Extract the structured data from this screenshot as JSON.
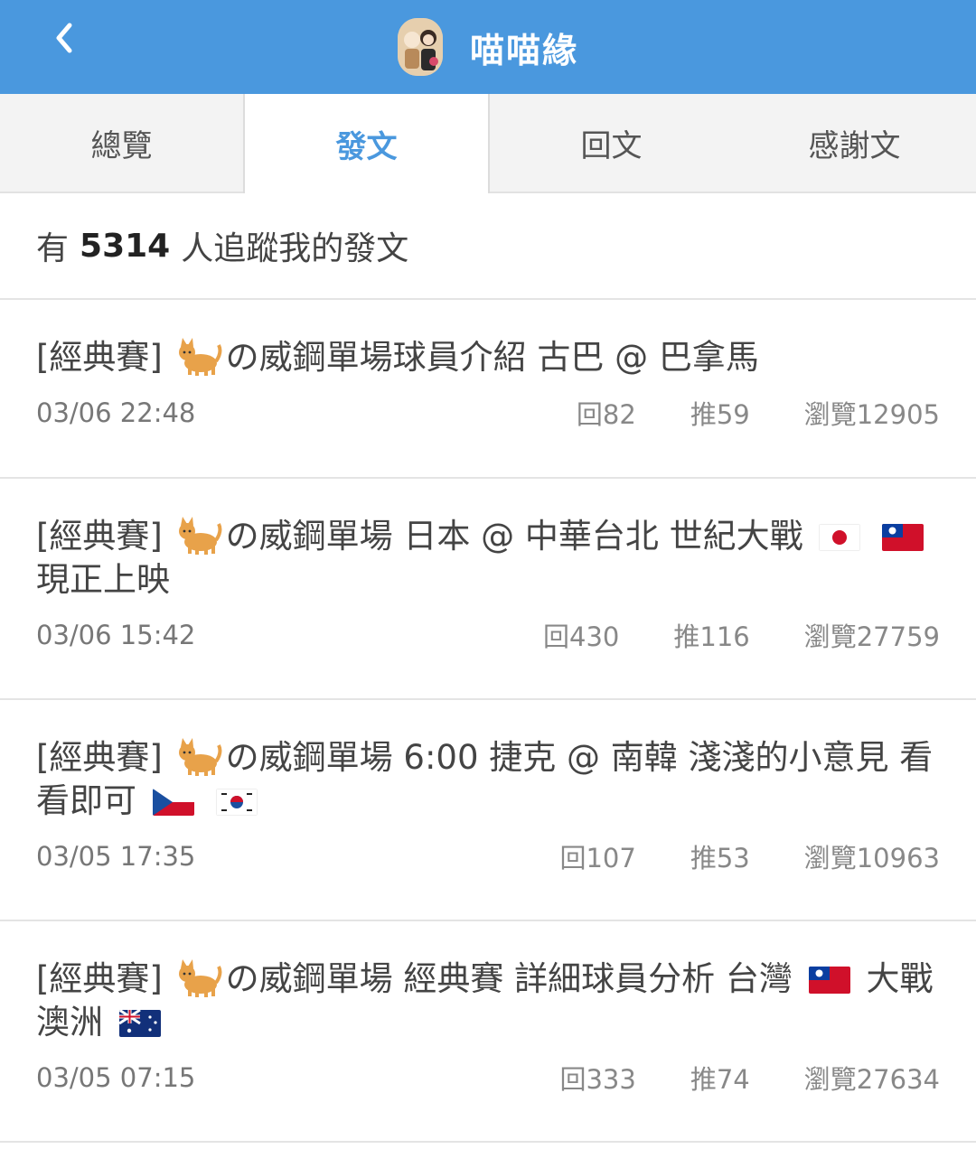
{
  "header": {
    "back_icon": "chevron-left-icon",
    "title": "喵喵緣"
  },
  "tabs": [
    {
      "label": "總覽",
      "active": false
    },
    {
      "label": "發文",
      "active": true
    },
    {
      "label": "回文",
      "active": false
    },
    {
      "label": "感謝文",
      "active": false
    }
  ],
  "followers": {
    "prefix": "有",
    "count": "5314",
    "suffix": "人追蹤我的發文"
  },
  "posts": [
    {
      "tag": "[經典賽]",
      "emoji": "cat-emoji",
      "title": "の威鋼單場球員介紹 古巴 @ 巴拿馬",
      "time": "03/06 22:48",
      "replies": "回82",
      "likes": "推59",
      "views": "瀏覽12905"
    },
    {
      "tag": "[經典賽]",
      "emoji": "cat-emoji",
      "title": "の威鋼單場 日本 @ 中華台北 世紀大戰",
      "title_after": "現正上映",
      "flags": [
        "japan-flag",
        "taiwan-flag"
      ],
      "time": "03/06 15:42",
      "replies": "回430",
      "likes": "推116",
      "views": "瀏覽27759"
    },
    {
      "tag": "[經典賽]",
      "emoji": "cat-emoji",
      "title": "の威鋼單場 6:00 捷克 @ 南韓 淺淺的小意見 看看即可",
      "flags": [
        "czech-flag",
        "korea-flag"
      ],
      "time": "03/05 17:35",
      "replies": "回107",
      "likes": "推53",
      "views": "瀏覽10963"
    },
    {
      "tag": "[經典賽]",
      "emoji": "cat-emoji",
      "title": "の威鋼單場 經典賽 詳細球員分析 台灣",
      "title_after": "大戰澳洲",
      "flags": [
        "taiwan-flag",
        "australia-flag"
      ],
      "time": "03/05 07:15",
      "replies": "回333",
      "likes": "推74",
      "views": "瀏覽27634"
    }
  ],
  "colors": {
    "header_bg": "#4a98de",
    "active_tab": "#4a98de"
  }
}
